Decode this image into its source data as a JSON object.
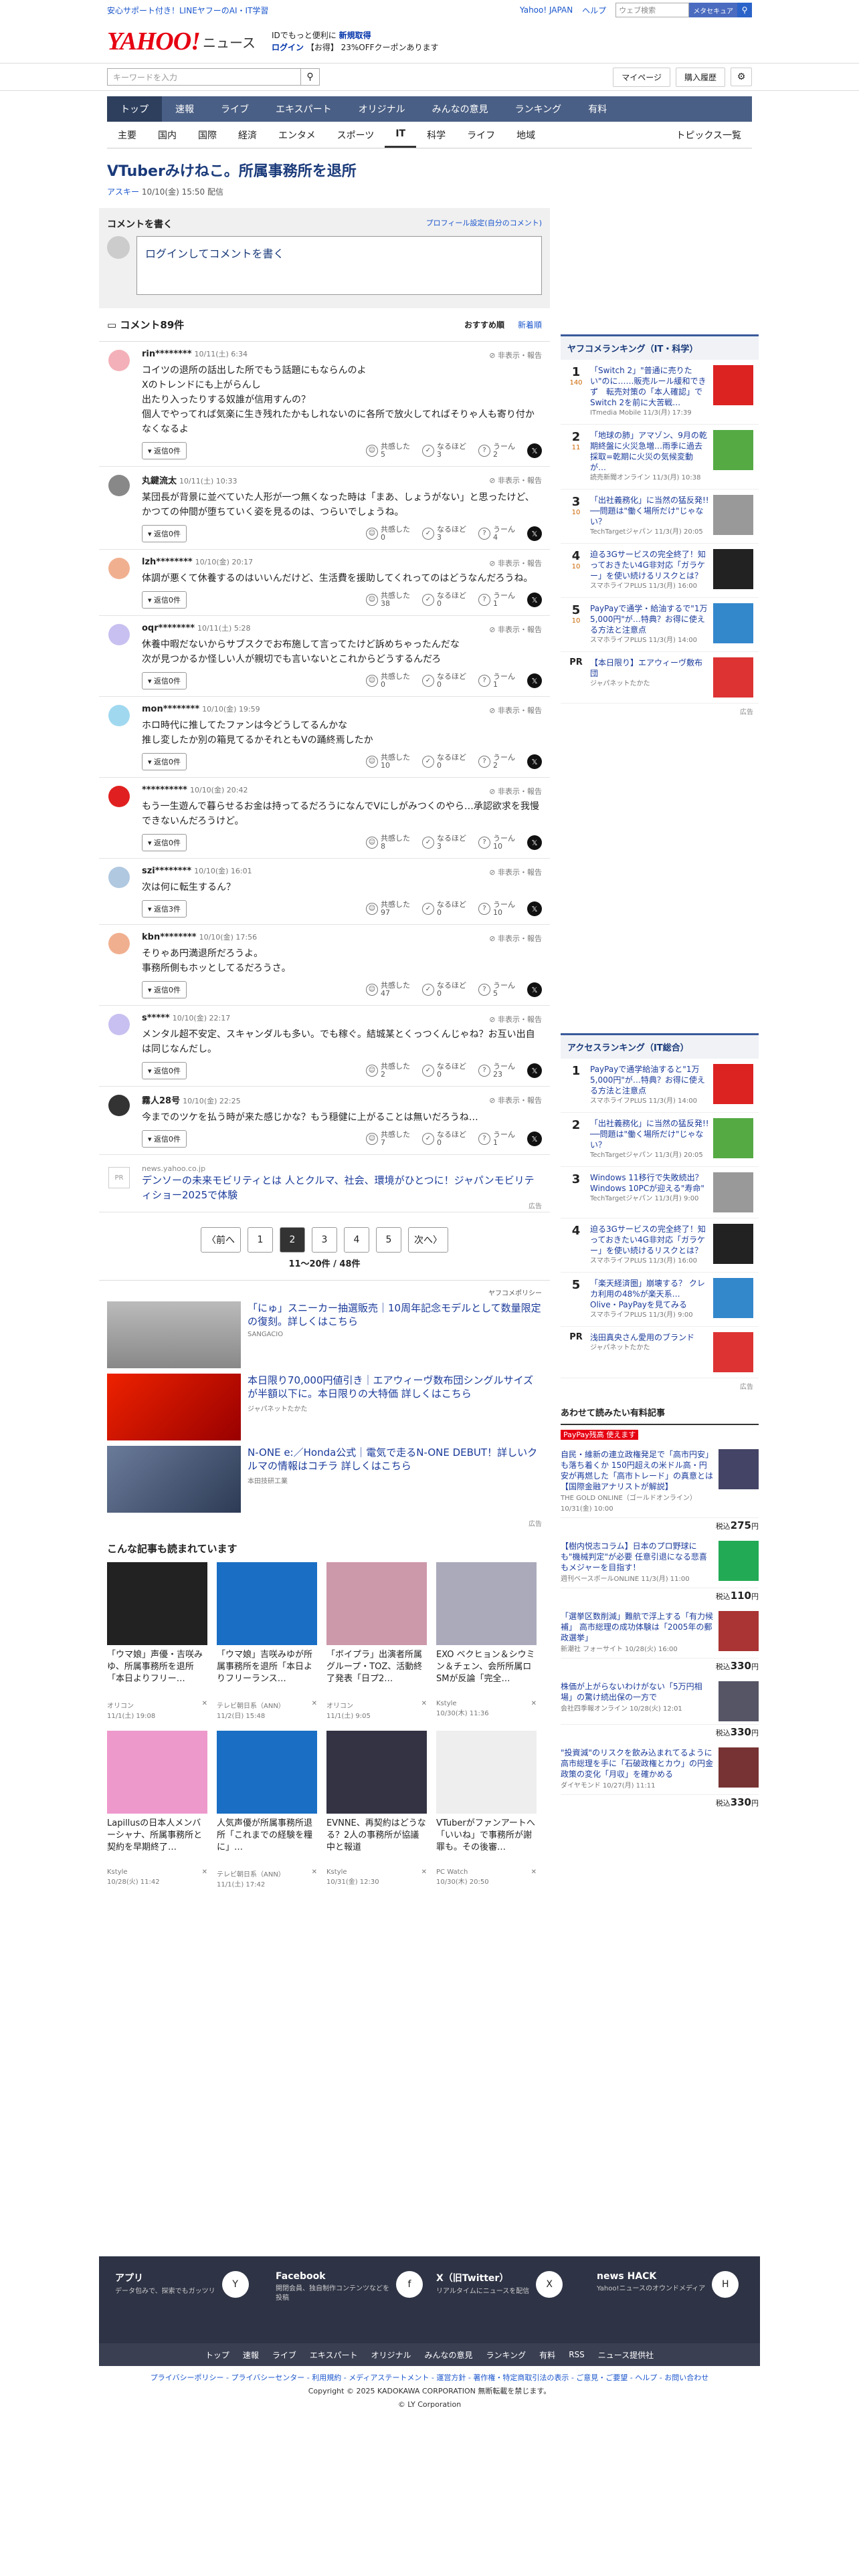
{
  "header": {
    "top_left": "安心サポート付き！LINEヤフーのAI・IT学習",
    "top_links": [
      "Yahoo! JAPAN",
      "ヘルプ"
    ],
    "search_placeholder": "ウェブ検索",
    "search_btn": "メタセキュア",
    "logo": "YAHOO!",
    "logo_sub": "ニュース",
    "promo1": "IDでもっと便利に",
    "promo1b": "新規取得",
    "promo2": "ログイン",
    "promo2b": "【お得】 23%OFFクーポンあります",
    "kw_placeholder": "キーワードを入力",
    "mypage": "マイページ",
    "history": "購入履歴"
  },
  "gnav": [
    "トップ",
    "速報",
    "ライブ",
    "エキスパート",
    "オリジナル",
    "みんなの意見",
    "ランキング",
    "有料"
  ],
  "snav": [
    "主要",
    "国内",
    "国際",
    "経済",
    "エンタメ",
    "スポーツ",
    "IT",
    "科学",
    "ライフ",
    "地域",
    "トピックス一覧"
  ],
  "article": {
    "title": "VTuberみけねこ。所属事務所を退所",
    "source": "アスキー",
    "date": "10/10(金) 15:50 配信"
  },
  "cform": {
    "title": "コメントを書く",
    "profile": "プロフィール設定(自分のコメント)",
    "placeholder": "ログインしてコメントを書く"
  },
  "chead": {
    "title": "コメント89件",
    "sort1": "おすすめ順",
    "sort2": "新着順"
  },
  "comments": [
    {
      "user": "rin********",
      "date": "10/11(土) 6:34",
      "body": "コイツの退所の話出した所でもう話題にもならんのよ\nXのトレンドにも上がらんし\n出たり入ったりする奴誰が信用すんの？\n個人でやってれば気楽に生き残れたかもしれないのに各所で放火してればそりゃ人も寄り付かなくなるよ",
      "reply": "返信0件",
      "a": "5",
      "b": "3",
      "c": "2",
      "color": "#f3b0b8"
    },
    {
      "user": "丸鍵流太",
      "date": "10/11(土) 10:33",
      "body": "某団長が背景に並べていた人形が一つ無くなった時は「まあ、しょうがない」と思ったけど、かつての仲間が堕ちていく姿を見るのは、つらいでしょうね。",
      "reply": "返信0件",
      "a": "0",
      "b": "3",
      "c": "4",
      "color": "#888"
    },
    {
      "user": "lzh********",
      "date": "10/10(金) 20:17",
      "body": "体調が悪くて休養するのはいいんだけど、生活費を援助してくれってのはどうなんだろうね。",
      "reply": "返信0件",
      "a": "38",
      "b": "0",
      "c": "1",
      "color": "#f0b090"
    },
    {
      "user": "oqr********",
      "date": "10/11(土) 5:28",
      "body": "休養中暇だないからサブスクでお布施して言ってたけど訴めちゃったんだな\n次が見つかるか怪しい人が親切でも言いないとこれからどうするんだろ",
      "reply": "返信0件",
      "a": "0",
      "b": "0",
      "c": "1",
      "color": "#c8c0f0"
    },
    {
      "user": "mon********",
      "date": "10/10(金) 19:59",
      "body": "ホロ時代に推してたファンは今どうしてるんかな\n推し変したか別の箱見てるかそれともVの踊終焉したか",
      "reply": "返信0件",
      "a": "10",
      "b": "0",
      "c": "2",
      "color": "#a0d8f0"
    },
    {
      "user": "**********",
      "date": "10/10(金) 20:42",
      "body": "もう一生遊んで暮らせるお金は持ってるだろうになんでVにしがみつくのやら…承認欲求を我慢できないんだろうけど。",
      "reply": "返信0件",
      "a": "8",
      "b": "3",
      "c": "10",
      "color": "#e02020"
    },
    {
      "user": "szi********",
      "date": "10/10(金) 16:01",
      "body": "次は何に転生するん？",
      "reply": "返信3件",
      "a": "97",
      "b": "0",
      "c": "10",
      "color": "#b0c8e0"
    },
    {
      "user": "kbn********",
      "date": "10/10(金) 17:56",
      "body": "そりゃあ円満退所だろうよ。\n事務所側もホッとしてるだろうさ。",
      "reply": "返信0件",
      "a": "47",
      "b": "0",
      "c": "5",
      "color": "#f0b090"
    },
    {
      "user": "s*****",
      "date": "10/10(金) 22:17",
      "body": "メンタル超不安定、スキャンダルも多い。でも稼ぐ。結城某とくっつくんじゃね？お互い出自は同じなんだし。",
      "reply": "返信0件",
      "a": "2",
      "b": "0",
      "c": "23",
      "color": "#c8c0f0"
    },
    {
      "user": "霧人28号",
      "date": "10/10(金) 22:25",
      "body": "今までのツケを払う時が来た感じかな？もう穏健に上がることは無いだろうね…",
      "reply": "返信0件",
      "a": "7",
      "b": "0",
      "c": "1",
      "color": "#333"
    }
  ],
  "reactions": {
    "a": "共感した",
    "b": "なるほど",
    "c": "うーん",
    "report": "非表示・報告"
  },
  "adrow": {
    "src": "news.yahoo.co.jp",
    "title": "デンソーの未来モビリティとは 人とクルマ、社会、環境がひとつに！ジャパンモビリティショー2025で体験",
    "label": "広告"
  },
  "pager": {
    "prev": "〈前へ",
    "pages": [
      "1",
      "2",
      "3",
      "4",
      "5"
    ],
    "next": "次へ〉",
    "count": "11〜20件 / 48件"
  },
  "ads": {
    "policy": "ヤフコメポリシー",
    "items": [
      {
        "title": "「にゅ」スニーカー抽選販売｜10周年記念モデルとして数量限定の復刻。詳しくはこちら",
        "sponsor": "SANGACIO"
      },
      {
        "title": "本日限り70,000円値引き｜エアウィーヴ数布団シングルサイズが半額以下に。本日限りの大特価 詳しくはこちら",
        "sponsor": "ジャパネットたかた"
      },
      {
        "title": "N-ONE e:／Honda公式｜電気で走るN-ONE DEBUT！詳しいクルマの情報はコチラ 詳しくはこちら",
        "sponsor": "本田技研工業"
      }
    ],
    "label": "広告"
  },
  "related": {
    "title": "こんな記事も読まれています",
    "cards": [
      {
        "title": "「ウマ娘」声優・吉咲みゆ、所属事務所を退所「本日よりフリー…",
        "src": "オリコン",
        "date": "11/1(土) 19:08"
      },
      {
        "title": "「ウマ娘」吉咲みゆが所属事務所を退所「本日よりフリーランス…",
        "src": "テレビ朝日系（ANN）",
        "date": "11/2(日) 15:48"
      },
      {
        "title": "「ボイプラ」出演者所属グループ・TOZ、活動終了発表「日プ2…",
        "src": "オリコン",
        "date": "11/1(土) 9:05"
      },
      {
        "title": "EXO ベクヒョン＆シウミン＆チェン、会所所属ロSMが反論「完全…",
        "src": "Kstyle",
        "date": "10/30(木) 11:36"
      },
      {
        "title": "Lapillusの日本人メンバーシャナ、所属事務所と契約を早期終了…",
        "src": "Kstyle",
        "date": "10/28(火) 11:42"
      },
      {
        "title": "人気声優が所属事務所退所「これまでの経験を糧に」…",
        "src": "テレビ朝日系（ANN）",
        "date": "11/1(土) 17:42"
      },
      {
        "title": "EVNNE、再契約はどうなる？2人の事務所が協議中と報道",
        "src": "Kstyle",
        "date": "10/31(金) 12:30"
      },
      {
        "title": "VTuberがファンアートへ「いいね」で事務所が謝罪も。その後審…",
        "src": "PC Watch",
        "date": "10/30(木) 20:50"
      }
    ]
  },
  "rank1": {
    "title": "ヤフコメランキング（IT・科学）",
    "items": [
      {
        "n": "1",
        "c": "140",
        "t": "「Switch 2」\"普通に売りたい\"のに……販売ルール緩和できず　転売対策の「本人確認」でSwitch 2を前に大苦戦…",
        "s": "ITmedia Mobile",
        "d": "11/3(月) 17:39"
      },
      {
        "n": "2",
        "c": "11",
        "t": "「地球の肺」アマゾン、9月の乾期終盤に火災急増…雨季に過去採取=乾期に火災の気候変動が…",
        "s": "読売新聞オンライン",
        "d": "11/3(月) 10:38"
      },
      {
        "n": "3",
        "c": "10",
        "t": "「出社義務化」に当然の猛反発!!　──問題は\"働く場所だけ\"じゃない？",
        "s": "TechTargetジャパン",
        "d": "11/3(月) 20:05"
      },
      {
        "n": "4",
        "c": "10",
        "t": "迫る3Gサービスの完全終了！知っておきたい4G非対応「ガラケー」を使い続けるリスクとは？",
        "s": "スマホライフPLUS",
        "d": "11/3(月) 16:00"
      },
      {
        "n": "5",
        "c": "10",
        "t": "PayPayで通学・給油するで\"1万5,000円\"が…特典？お得に使える方法と注意点",
        "s": "スマホライフPLUS",
        "d": "11/3(月) 14:00"
      }
    ],
    "pr": "【本日限り】エアウィーヴ敷布団",
    "pr_src": "ジャパネットたかた",
    "label": "広告"
  },
  "rank2": {
    "title": "アクセスランキング（IT総合）",
    "items": [
      {
        "n": "1",
        "t": "PayPayで通学給油すると\"1万5,000円\"が…特典？お得に使える方法と注意点",
        "s": "スマホライフPLUS",
        "d": "11/3(月) 14:00"
      },
      {
        "n": "2",
        "t": "「出社義務化」に当然の猛反発!!　──問題は\"働く場所だけ\"じゃない？",
        "s": "TechTargetジャパン",
        "d": "11/3(月) 20:05"
      },
      {
        "n": "3",
        "t": "Windows 11移行で失敗続出？Windows 10PCが迎える\"寿命\"",
        "s": "TechTargetジャパン",
        "d": "11/3(月) 9:00"
      },
      {
        "n": "4",
        "t": "迫る3Gサービスの完全終了！知っておきたい4G非対応「ガラケー」を使い続けるリスクとは？",
        "s": "スマホライフPLUS",
        "d": "11/3(月) 16:00"
      },
      {
        "n": "5",
        "t": "「楽天経済圏」崩壊する？ クレカ利用の48%が楽天系… Olive・PayPayを見てみる",
        "s": "スマホライフPLUS",
        "d": "11/3(月) 9:00"
      }
    ],
    "pr": "浅田真央さん愛用のブランド",
    "pr_src": "ジャパネットたかた",
    "label": "広告"
  },
  "paid": {
    "title": "あわせて読みたい有料記事",
    "badge": "PayPay残高 使えます",
    "items": [
      {
        "t": "自民・維新の連立政権発足で「高市円安」も落ち着くか 150円超えの米ドル高・円安が再燃した「高市トレード」の真意とは【国際金融アナリストが解説】",
        "s": "THE GOLD ONLINE（ゴールドオンライン） 10/31(金) 10:00",
        "p": "275"
      },
      {
        "t": "【樹内悦志コラム】日本のプロ野球にも\"機械判定\"が必要 任意引退になる悲喜もメジャーを目指す！",
        "s": "週刊ベースボールONLINE 11/3(月) 11:00",
        "p": "110"
      },
      {
        "t": "「選挙区数削減」難航で浮上する「有力候補」 高市総理の成功体験は「2005年の郵政選挙」",
        "s": "新潮社 フォーサイト 10/28(火) 16:00",
        "p": "330"
      },
      {
        "t": "株価が上がらないわけがない「5万円相場」の驚け続出保の一方で",
        "s": "会社四季報オンライン 10/28(火) 12:01",
        "p": "330"
      },
      {
        "t": "\"投資減\"のリスクを飲み込まれてるように 高市総理を手に「石破政権とカウ」の円金政策の変化「月収」を確かめる",
        "s": "ダイヤモンド 10/27(月) 11:11",
        "p": "330"
      }
    ],
    "yen": "税込"
  },
  "footer": {
    "cells": [
      {
        "t": "アプリ",
        "d": "データ包みで、探索でもガッツリ",
        "i": "Y"
      },
      {
        "t": "Facebook",
        "d": "開閉会員、独自制作コンテンツなどを投稿",
        "i": "f"
      },
      {
        "t": "X（旧Twitter）",
        "d": "リアルタイムにニュースを配信",
        "i": "X"
      },
      {
        "t": "news HACK",
        "d": "Yahoo!ニュースのオウンドメディア",
        "i": "H"
      }
    ],
    "nav": [
      "トップ",
      "速報",
      "ライブ",
      "エキスパート",
      "オリジナル",
      "みんなの意見",
      "ランキング",
      "有料",
      "RSS",
      "ニュース提供社"
    ],
    "links": "プライバシーポリシー - プライバシーセンター - 利用規約 - メディアステートメント - 運営方針 - 著作権・特定商取引法の表示 - ご意見・ご要望 - ヘルプ - お問い合わせ",
    "copy1": "Copyright © 2025 KADOKAWA CORPORATION 無断転載を禁じます。",
    "copy2": "© LY Corporation"
  }
}
